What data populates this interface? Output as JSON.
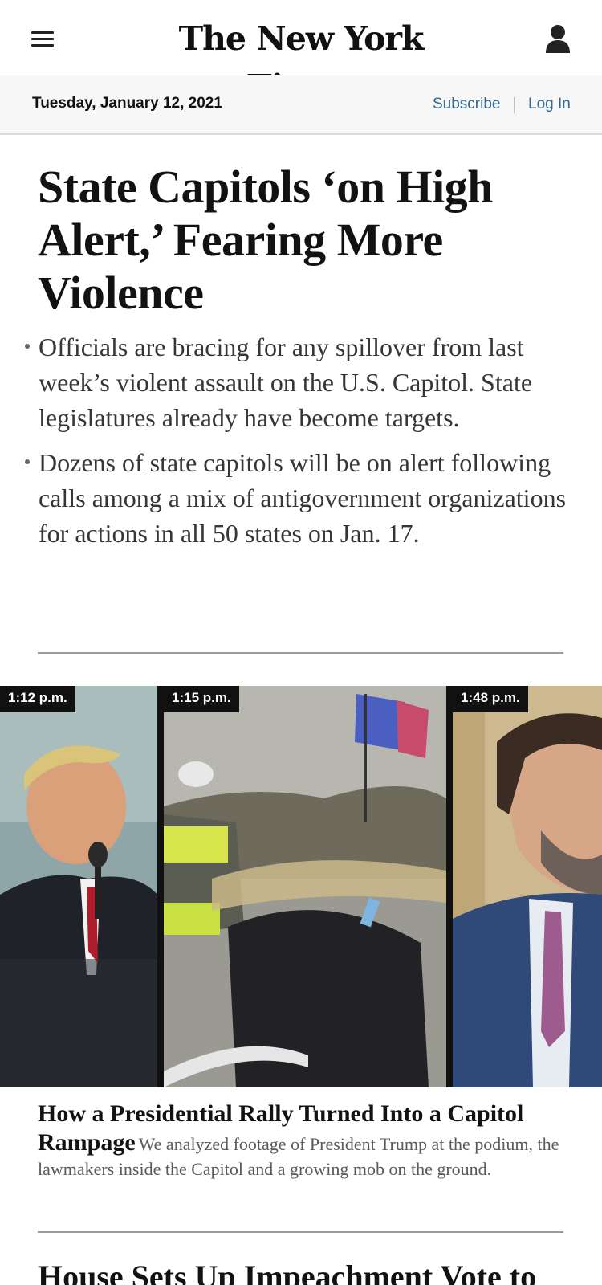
{
  "header": {
    "logo_text": "The New York Times",
    "menu_icon": "hamburger-menu-icon",
    "account_icon": "user-account-icon"
  },
  "datebar": {
    "date": "Tuesday, January 12, 2021",
    "subscribe_label": "Subscribe",
    "login_label": "Log In",
    "link_color": "#326891"
  },
  "lead_story": {
    "headline": "State Capitols ‘on High Alert,’ Fearing More Violence",
    "bullets": [
      "Officials are bracing for any spillover from last week’s violent assault on the U.S. Capitol. State legislatures already have become targets.",
      "Dozens of state capitols will be on alert following calls among a mix of antigovernment organizations for actions in all 50 states on Jan. 17."
    ]
  },
  "video_strip": {
    "panels": [
      {
        "time": "1:12 p.m."
      },
      {
        "time": "1:15 p.m."
      },
      {
        "time": "1:48 p.m."
      }
    ]
  },
  "feature": {
    "title": "How a Presidential Rally Turned Into a Capitol Rampage",
    "summary": "We analyzed footage of President Trump at the podium, the lawmakers inside the Capitol and a growing mob on the ground."
  },
  "next_story": {
    "headline": "House Sets Up Impeachment Vote to"
  }
}
